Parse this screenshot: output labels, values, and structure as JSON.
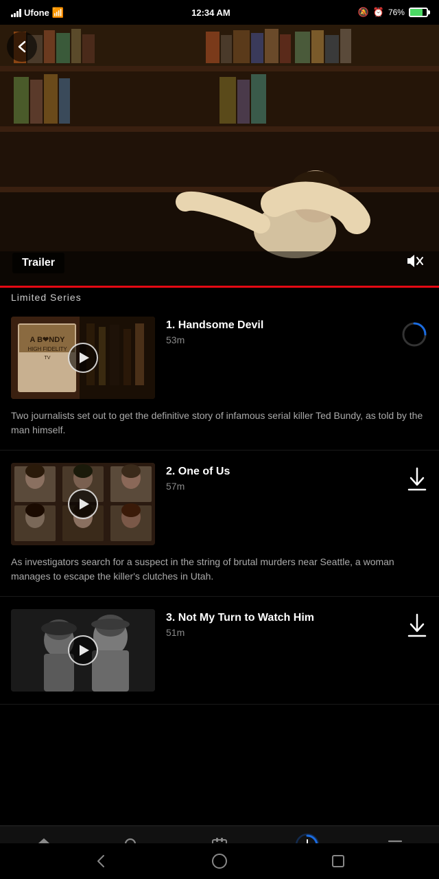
{
  "statusBar": {
    "carrier": "Ufone",
    "time": "12:34 AM",
    "battery": "76%"
  },
  "hero": {
    "trailerLabel": "Trailer",
    "muteIcon": "🔇"
  },
  "limitedSeries": {
    "tag": "Limited Series"
  },
  "episodes": [
    {
      "number": "1",
      "title": "Handsome Devil",
      "duration": "53m",
      "description": "Two journalists set out to get the definitive story of infamous serial killer Ted Bundy, as told by the man himself.",
      "actionType": "loading"
    },
    {
      "number": "2",
      "title": "One of Us",
      "duration": "57m",
      "description": "As investigators search for a suspect in the string of brutal murders near Seattle, a woman manages to escape the killer's clutches in Utah.",
      "actionType": "download"
    },
    {
      "number": "3",
      "title": "Not My Turn to Watch Him",
      "duration": "51m",
      "description": "",
      "actionType": "download"
    }
  ],
  "bottomNav": {
    "items": [
      {
        "id": "home",
        "label": "Home",
        "icon": "home",
        "active": false
      },
      {
        "id": "search",
        "label": "Search",
        "icon": "search",
        "active": false
      },
      {
        "id": "coming-soon",
        "label": "Coming Soon",
        "icon": "coming-soon",
        "active": false
      },
      {
        "id": "downloads",
        "label": "Downloads",
        "icon": "downloads",
        "active": true
      },
      {
        "id": "more",
        "label": "More",
        "icon": "more",
        "active": false
      }
    ]
  },
  "androidNav": {
    "back": "◁",
    "home": "○",
    "recent": "□"
  }
}
